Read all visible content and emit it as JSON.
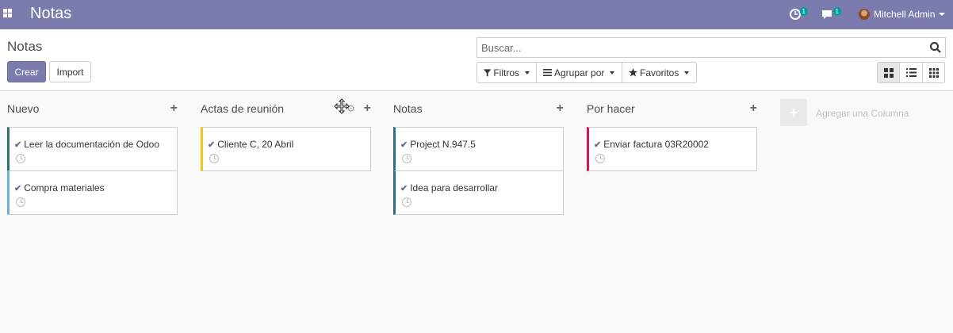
{
  "navbar": {
    "app_title": "Notas",
    "activity_badge": "1",
    "chat_badge": "1",
    "user_name": "Mitchell Admin",
    "color": "#7c7bad"
  },
  "control_panel": {
    "breadcrumb": "Notas",
    "create_label": "Crear",
    "import_label": "Import",
    "search_placeholder": "Buscar...",
    "filters_label": "Filtros",
    "groupby_label": "Agrupar por",
    "favorites_label": "Favoritos"
  },
  "kanban": {
    "columns": [
      {
        "title": "Nuevo",
        "cards": [
          {
            "title": "Leer la documentación de Odoo",
            "color": "#2c6f7a"
          },
          {
            "title": "Compra materiales",
            "color": "#6fb1d9"
          }
        ]
      },
      {
        "title": "Actas de reunión",
        "cards": [
          {
            "title": "Cliente C, 20 Abril",
            "color": "#f0c419"
          }
        ]
      },
      {
        "title": "Notas",
        "cards": [
          {
            "title": "Project N.947.5",
            "color": "#2c6f7a"
          },
          {
            "title": "Idea para desarrollar",
            "color": "#2c6f7a"
          }
        ]
      },
      {
        "title": "Por hacer",
        "cards": [
          {
            "title": "Enviar factura 03R20002",
            "color": "#d6145f"
          }
        ]
      }
    ],
    "add_column_label": "Agregar una Columna"
  }
}
